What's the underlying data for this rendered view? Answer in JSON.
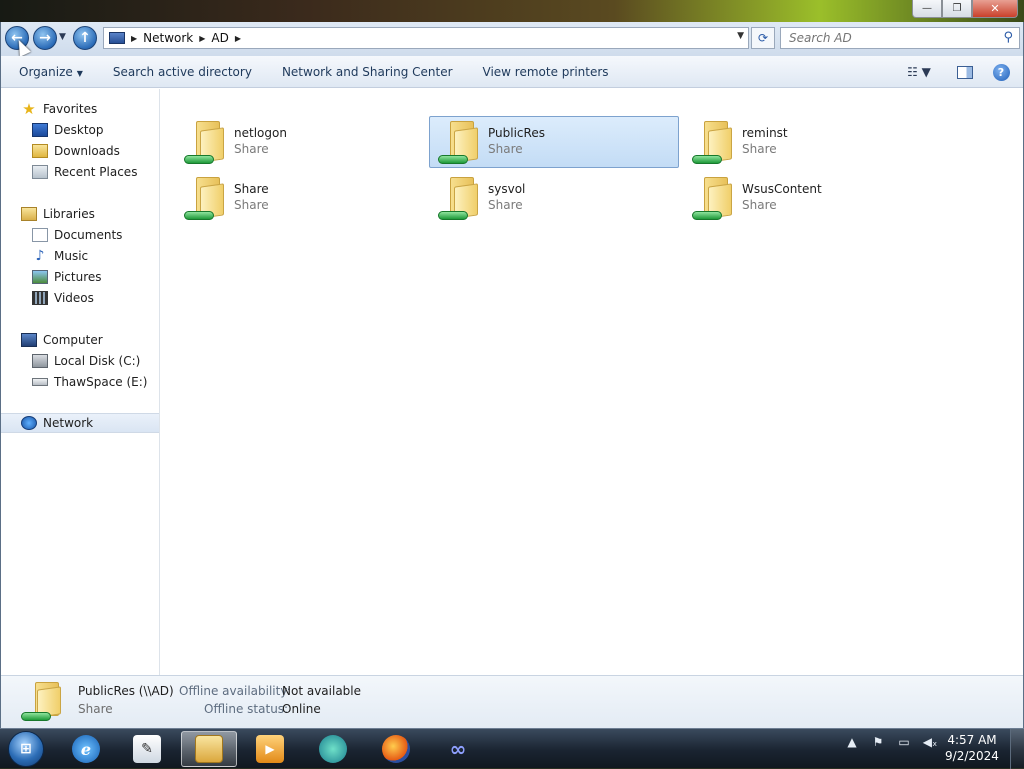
{
  "window": {
    "caption_buttons": {
      "minimize": "—",
      "restore": "❐",
      "close": "✕"
    }
  },
  "address": {
    "crumbs": [
      "Network",
      "AD"
    ],
    "search_placeholder": "Search AD"
  },
  "command_bar": {
    "organize": "Organize",
    "search_ad": "Search active directory",
    "network_sharing": "Network and Sharing Center",
    "remote_printers": "View remote printers"
  },
  "nav_pane": {
    "favorites": {
      "label": "Favorites",
      "items": [
        "Desktop",
        "Downloads",
        "Recent Places"
      ]
    },
    "libraries": {
      "label": "Libraries",
      "items": [
        "Documents",
        "Music",
        "Pictures",
        "Videos"
      ]
    },
    "computer": {
      "label": "Computer",
      "items": [
        "Local Disk (C:)",
        "ThawSpace (E:)"
      ]
    },
    "network": {
      "label": "Network",
      "selected": true
    }
  },
  "shares": [
    {
      "name": "netlogon",
      "type": "Share",
      "selected": false
    },
    {
      "name": "PublicRes",
      "type": "Share",
      "selected": true
    },
    {
      "name": "reminst",
      "type": "Share",
      "selected": false
    },
    {
      "name": "Share",
      "type": "Share",
      "selected": false
    },
    {
      "name": "sysvol",
      "type": "Share",
      "selected": false
    },
    {
      "name": "WsusContent",
      "type": "Share",
      "selected": false
    }
  ],
  "details": {
    "name": "PublicRes (\\\\AD)",
    "type": "Share",
    "offline_availability_label": "Offline availability:",
    "offline_availability_value": "Not available",
    "offline_status_label": "Offline status:",
    "offline_status_value": "Online"
  },
  "taskbar": {
    "apps": [
      "internet-explorer",
      "notepad",
      "windows-explorer",
      "media-player",
      "globe-app",
      "firefox",
      "visual-studio"
    ],
    "active_app": "windows-explorer",
    "time": "4:57 AM",
    "date": "9/2/2024"
  },
  "colors": {
    "selection": "#c3dcf5",
    "command_text": "#1e395b",
    "share_type_text": "#7a7a7a"
  }
}
